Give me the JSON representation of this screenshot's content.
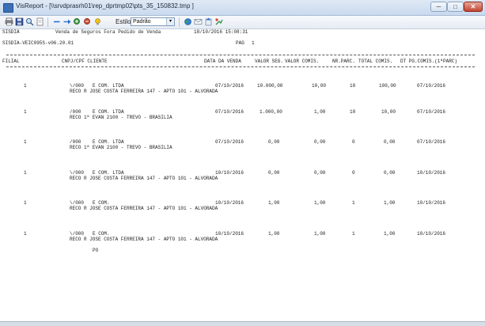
{
  "window": {
    "title": "VisReport - [\\\\srvdprasrh01\\rep_dprtmp02\\pts_35_150832.tmp ]",
    "min_glyph": "─",
    "max_glyph": "□",
    "close_glyph": "✕"
  },
  "toolbar": {
    "estilo_label": "Estilo:",
    "style_value": "Padrão",
    "style_arrow": "▾"
  },
  "report": {
    "header": {
      "line1_left": "SISDIA",
      "line1_title": "Venda de Seguros Fora Pedido de Venda",
      "line1_datetime": "18/10/2016  15:08:31",
      "line2_left": "SISDIA-VEIC095S-v06.20.01",
      "page_label": "PAG",
      "page_value": "1"
    },
    "columns": {
      "filial": "FILIAL",
      "cnpj": "CNPJ/CPF  CLIENTE",
      "data": "DATA DA VENDA",
      "valor_seg": "VALOR SEG.",
      "valor_comis": "VALOR COMIS.",
      "nr_parc": "NR.PARC.",
      "total_comis": "TOTAL COMIS.",
      "dt_pg": "DT PG.COMIS.(1ªPARC)"
    },
    "rows": [
      {
        "filial": "1",
        "cnpj": "\\/000",
        "cliente": "E COM. LTDA",
        "endereco": "RECO  R JOSE COSTA FERREIRA 147 - APTO 101 - ALVORADA",
        "extra": "",
        "data": "07/10/2016",
        "valor_seg": "10.000,00",
        "valor_comis": "10,00",
        "nr_parc": "10",
        "total_comis": "100,00",
        "dt_pg": "07/10/2016"
      },
      {
        "filial": "1",
        "cnpj": "/000",
        "cliente": "E COM. LTDA",
        "endereco": "RECO  1ª EVAN 2100 - TREVO - BRASILIA",
        "extra": "",
        "data": "07/10/2016",
        "valor_seg": "1.000,00",
        "valor_comis": "1,00",
        "nr_parc": "10",
        "total_comis": "10,00",
        "dt_pg": "07/10/2016"
      },
      {
        "filial": "1",
        "cnpj": "/000",
        "cliente": "E COM. LTDA",
        "endereco": "RECO  1ª EVAN 2100 - TREVO - BRASILIA",
        "extra": "",
        "data": "07/10/2016",
        "valor_seg": "0,00",
        "valor_comis": "0,00",
        "nr_parc": "0",
        "total_comis": "0,00",
        "dt_pg": "07/10/2016"
      },
      {
        "filial": "1",
        "cnpj": "\\/000",
        "cliente": "E COM. LTDA",
        "endereco": "RECO  R JOSE COSTA FERREIRA 147 - APTO 101 - ALVORADA",
        "extra": "",
        "data": "10/10/2016",
        "valor_seg": "0,00",
        "valor_comis": "0,00",
        "nr_parc": "0",
        "total_comis": "0,00",
        "dt_pg": "10/10/2016"
      },
      {
        "filial": "1",
        "cnpj": "\\/000",
        "cliente": "E COM.",
        "endereco": "RECO  R JOSE COSTA FERREIRA 147 - APTO 101 - ALVORADA",
        "extra": "",
        "data": "10/10/2016",
        "valor_seg": "1,00",
        "valor_comis": "1,00",
        "nr_parc": "1",
        "total_comis": "1,00",
        "dt_pg": "10/10/2016"
      },
      {
        "filial": "1",
        "cnpj": "\\/000",
        "cliente": "E COM.",
        "endereco": "RECO  R JOSE COSTA FERREIRA 147 - APTO 101 - ALVORADA",
        "extra": "PO",
        "data": "10/10/2016",
        "valor_seg": "1,00",
        "valor_comis": "1,00",
        "nr_parc": "1",
        "total_comis": "1,00",
        "dt_pg": "10/10/2016"
      }
    ]
  }
}
